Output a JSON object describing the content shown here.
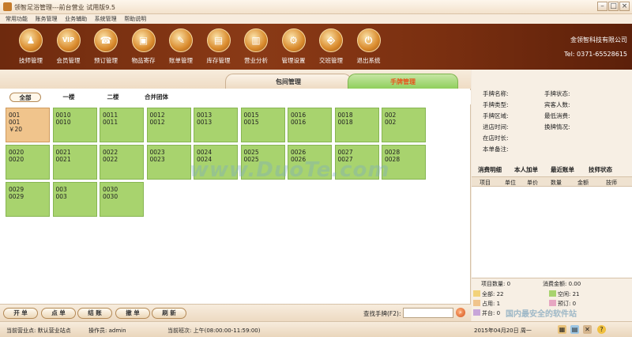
{
  "window": {
    "title": "领智足浴管理---前台营业 试用版9.5"
  },
  "menu": [
    "常用功能",
    "账务管理",
    "业务辅助",
    "系统管理",
    "帮助说明"
  ],
  "toolbar": [
    {
      "label": "技师管理",
      "icon": "people-icon",
      "glyph": "♟"
    },
    {
      "label": "会员管理",
      "icon": "vip-icon",
      "glyph": "VIP"
    },
    {
      "label": "预订管理",
      "icon": "phone-icon",
      "glyph": "☎"
    },
    {
      "label": "物品寄存",
      "icon": "storage-box-icon",
      "glyph": "▣"
    },
    {
      "label": "账单管理",
      "icon": "bill-icon",
      "glyph": "✎"
    },
    {
      "label": "库存管理",
      "icon": "folder-icon",
      "glyph": "▤"
    },
    {
      "label": "营业分析",
      "icon": "chart-icon",
      "glyph": "▥"
    },
    {
      "label": "管理设置",
      "icon": "gear-icon",
      "glyph": "⚙"
    },
    {
      "label": "交班管理",
      "icon": "door-icon",
      "glyph": "⎆"
    },
    {
      "label": "退出系统",
      "icon": "power-icon",
      "glyph": "⏻"
    }
  ],
  "company": {
    "name": "金领智科技有限公司",
    "tel": "Tel: 0371-65528615"
  },
  "tabs": {
    "room": "包间管理",
    "card": "手牌管理"
  },
  "filters": [
    "全部",
    "一楼",
    "二楼",
    "合并团体"
  ],
  "cards": [
    {
      "line1": "001",
      "line2": "001",
      "line3": "￥20",
      "status": "occupied"
    },
    {
      "line1": "0010",
      "line2": "0010",
      "line3": "",
      "status": "free"
    },
    {
      "line1": "0011",
      "line2": "0011",
      "line3": "",
      "status": "free"
    },
    {
      "line1": "0012",
      "line2": "0012",
      "line3": "",
      "status": "free"
    },
    {
      "line1": "0013",
      "line2": "0013",
      "line3": "",
      "status": "free"
    },
    {
      "line1": "0015",
      "line2": "0015",
      "line3": "",
      "status": "free"
    },
    {
      "line1": "0016",
      "line2": "0016",
      "line3": "",
      "status": "free"
    },
    {
      "line1": "0018",
      "line2": "0018",
      "line3": "",
      "status": "free"
    },
    {
      "line1": "002",
      "line2": "002",
      "line3": "",
      "status": "free"
    },
    {
      "line1": "0020",
      "line2": "0020",
      "line3": "",
      "status": "free"
    },
    {
      "line1": "0021",
      "line2": "0021",
      "line3": "",
      "status": "free"
    },
    {
      "line1": "0022",
      "line2": "0022",
      "line3": "",
      "status": "free"
    },
    {
      "line1": "0023",
      "line2": "0023",
      "line3": "",
      "status": "free"
    },
    {
      "line1": "0024",
      "line2": "0024",
      "line3": "",
      "status": "free"
    },
    {
      "line1": "0025",
      "line2": "0025",
      "line3": "",
      "status": "free"
    },
    {
      "line1": "0026",
      "line2": "0026",
      "line3": "",
      "status": "free"
    },
    {
      "line1": "0027",
      "line2": "0027",
      "line3": "",
      "status": "free"
    },
    {
      "line1": "0028",
      "line2": "0028",
      "line3": "",
      "status": "free"
    },
    {
      "line1": "0029",
      "line2": "0029",
      "line3": "",
      "status": "free"
    },
    {
      "line1": "003",
      "line2": "003",
      "line3": "",
      "status": "free"
    },
    {
      "line1": "0030",
      "line2": "0030",
      "line3": "",
      "status": "free"
    }
  ],
  "buttons": {
    "open": "开 单",
    "order": "点 单",
    "checkout": "结 账",
    "cancel": "撤 单",
    "refresh": "刷 新"
  },
  "search": {
    "label": "查找手牌(F2):",
    "value": ""
  },
  "info": {
    "card_name": "手牌名称:",
    "card_status": "手牌状态:",
    "card_type": "手牌类型:",
    "guest_count": "宾客人数:",
    "card_area": "手牌区域:",
    "min_spend": "最低消费:",
    "enter_time": "进店时间:",
    "shift_info": "换牌情况:",
    "duration": "在店时长:",
    "note": "本单备注:"
  },
  "detail_tabs": [
    "消费明细",
    "本人加单",
    "最近账单",
    "技师状态"
  ],
  "table_headers": [
    "项目",
    "单位",
    "单价",
    "数量",
    "金额",
    "技师"
  ],
  "stats": {
    "item_count_label": "项目数量:",
    "item_count": "0",
    "total_label": "消费金额:",
    "total": "0.00",
    "all_label": "全部:",
    "all": "22",
    "free_label": "空闲:",
    "free": "21",
    "occupied_label": "占用:",
    "occupied": "1",
    "reserved_label": "预订:",
    "reserved": "0",
    "merged_label": "并台:",
    "merged": "0"
  },
  "statusbar": {
    "site_label": "当前营业点:",
    "site": "默认营业站点",
    "operator_label": "操作员:",
    "operator": "admin",
    "shift_label": "当前班次:",
    "shift": "上午(08:00:00-11:59:00)",
    "date": "2015年04月20日  周一"
  },
  "colors": {
    "occupied": "#f0c48c",
    "free": "#a8d36e",
    "reserved": "#e7a7c2",
    "merged": "#c8a6d9",
    "accent": "#e8521a"
  },
  "watermark": {
    "main": "www.DuoTe.com",
    "corner": "国内最安全的软件站"
  }
}
